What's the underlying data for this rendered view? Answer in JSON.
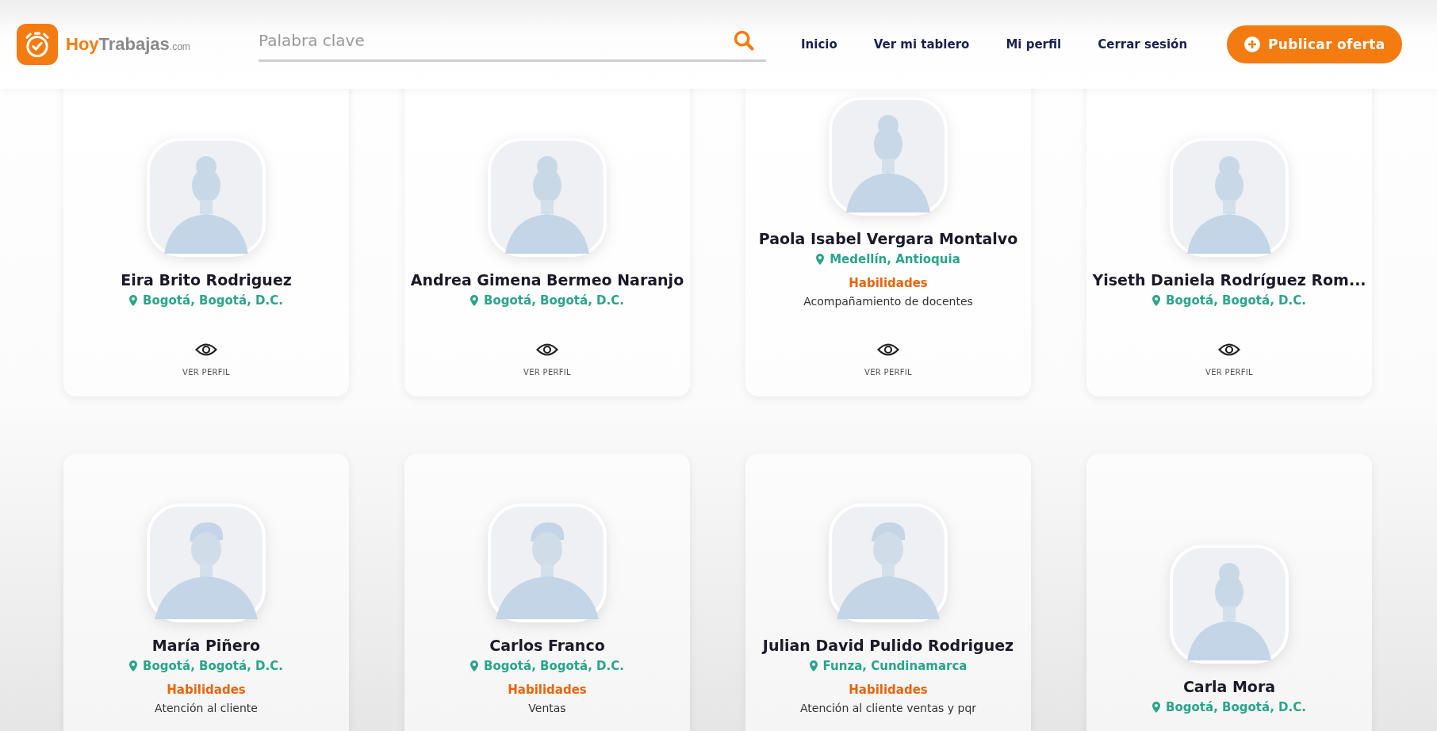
{
  "header": {
    "logo": {
      "first": "Hoy",
      "second": "Trabajas",
      "suffix": ".com"
    },
    "search": {
      "placeholder": "Palabra clave"
    },
    "nav": [
      "Inicio",
      "Ver mi tablero",
      "Mi perfil",
      "Cerrar sesión"
    ],
    "publish_button": "Publicar oferta"
  },
  "candidates": [
    {
      "name": "Eira Brito Rodriguez",
      "location": "Bogotá, Bogotá, D.C.",
      "kind": "bun",
      "view_label": "VER PERFIL"
    },
    {
      "name": "Andrea Gimena Bermeo Naranjo",
      "location": "Bogotá, Bogotá, D.C.",
      "kind": "bun",
      "view_label": "VER PERFIL"
    },
    {
      "name": "Paola Isabel Vergara Montalvo",
      "location": "Medellín, Antioquia",
      "skills_label": "Habilidades",
      "skills": "Acompañamiento de docentes",
      "kind": "bun",
      "view_label": "VER PERFIL"
    },
    {
      "name": "Yiseth Daniela Rodríguez Rom...",
      "location": "Bogotá, Bogotá, D.C.",
      "kind": "bun",
      "view_label": "VER PERFIL"
    },
    {
      "name": "María Piñero",
      "location": "Bogotá, Bogotá, D.C.",
      "skills_label": "Habilidades",
      "skills": "Atención al cliente",
      "kind": "short"
    },
    {
      "name": "Carlos Franco",
      "location": "Bogotá, Bogotá, D.C.",
      "skills_label": "Habilidades",
      "skills": "Ventas",
      "kind": "short"
    },
    {
      "name": "Julian David Pulido Rodriguez",
      "location": "Funza, Cundinamarca",
      "skills_label": "Habilidades",
      "skills": "Atención al cliente ventas y pqr",
      "kind": "short"
    },
    {
      "name": "Carla Mora",
      "location": "Bogotá, Bogotá, D.C.",
      "kind": "bun"
    }
  ]
}
